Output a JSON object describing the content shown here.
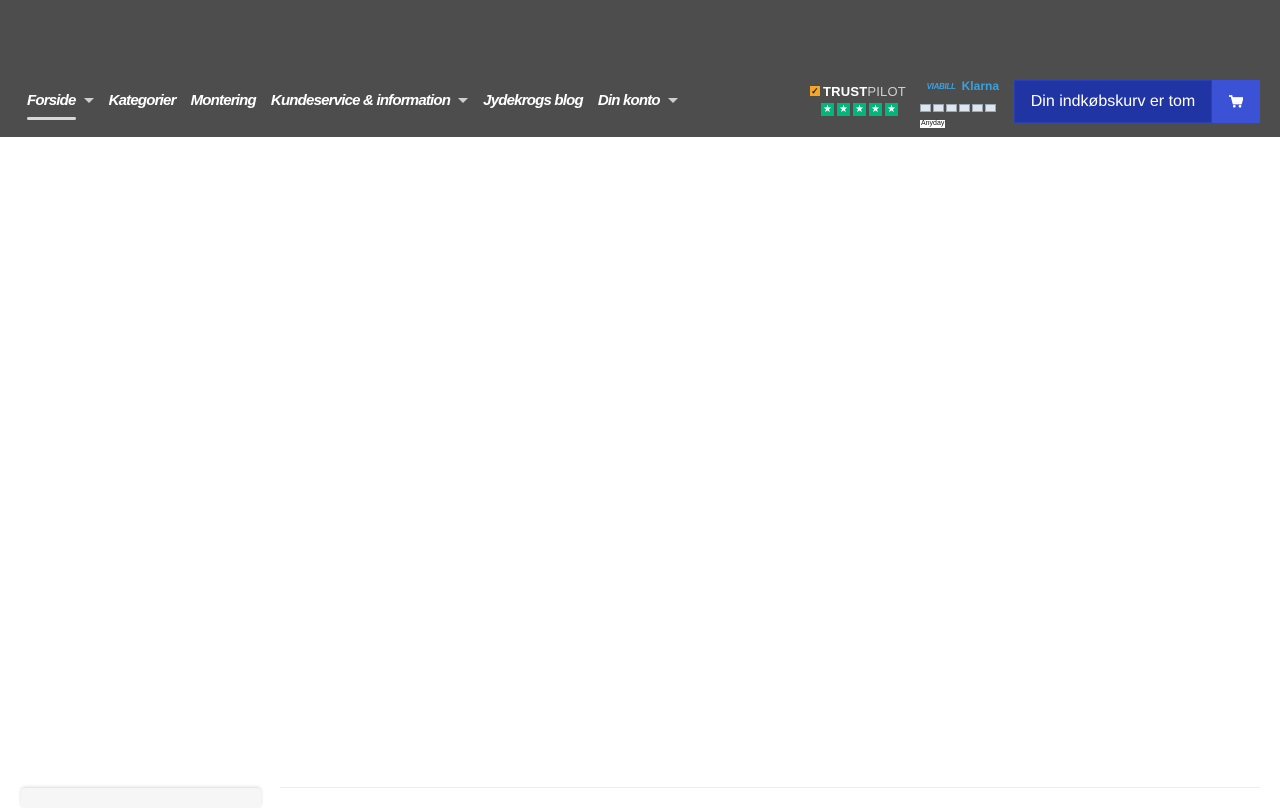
{
  "nav": {
    "items": [
      {
        "label": "Forside",
        "dropdown": true,
        "active": true
      },
      {
        "label": "Kategorier",
        "dropdown": false
      },
      {
        "label": "Montering",
        "dropdown": false
      },
      {
        "label": "Kundeservice & information",
        "dropdown": true
      },
      {
        "label": "Jydekrogs blog",
        "dropdown": false
      },
      {
        "label": "Din konto",
        "dropdown": true
      }
    ]
  },
  "trustpilot": {
    "brand_part1": "TRUST",
    "brand_part2": "PILOT",
    "stars": 5,
    "star_color": "#00b67a"
  },
  "payments": {
    "viabill": "VIABILL",
    "klarna": "Klarna",
    "anyday": "Anyday"
  },
  "cart": {
    "label": "Din indkøbskurv er tom",
    "icon": "shopping-cart-icon"
  },
  "colors": {
    "header_bg": "#4d4d4d",
    "cart_bg": "#2034a3",
    "cart_icon_bg": "#3b52d6"
  }
}
